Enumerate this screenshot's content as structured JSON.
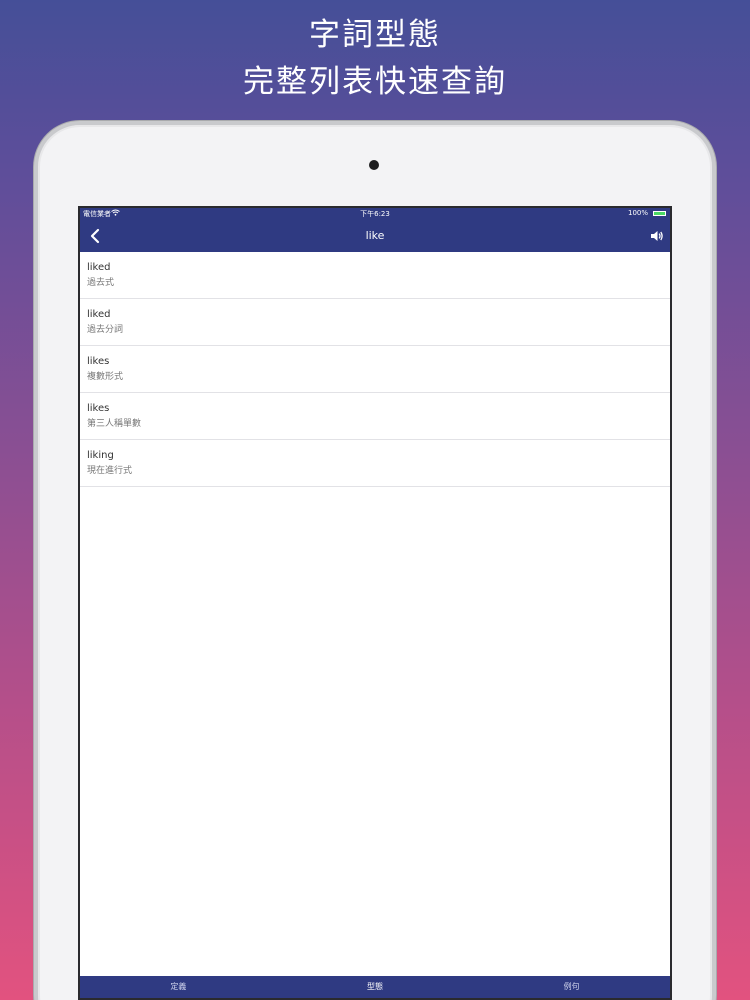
{
  "promo": {
    "line1": "字詞型態",
    "line2": "完整列表快速查詢"
  },
  "status_bar": {
    "carrier": "電信業者",
    "wifi_icon": "wifi-icon",
    "time": "下午6:23",
    "battery_percent": "100%",
    "battery_level": 1.0,
    "battery_color": "#4cd964"
  },
  "nav": {
    "back_icon": "chevron-left-icon",
    "title": "like",
    "speaker_icon": "speaker-icon"
  },
  "forms": [
    {
      "word": "liked",
      "form": "過去式"
    },
    {
      "word": "liked",
      "form": "過去分詞"
    },
    {
      "word": "likes",
      "form": "複數形式"
    },
    {
      "word": "likes",
      "form": "第三人稱單數"
    },
    {
      "word": "liking",
      "form": "現在進行式"
    }
  ],
  "tabs": [
    {
      "label": "定義",
      "active": false
    },
    {
      "label": "型態",
      "active": true
    },
    {
      "label": "例句",
      "active": false
    }
  ],
  "colors": {
    "bar": "#2f3a82",
    "background_top": "#454f98",
    "background_bottom": "#e2527f"
  }
}
